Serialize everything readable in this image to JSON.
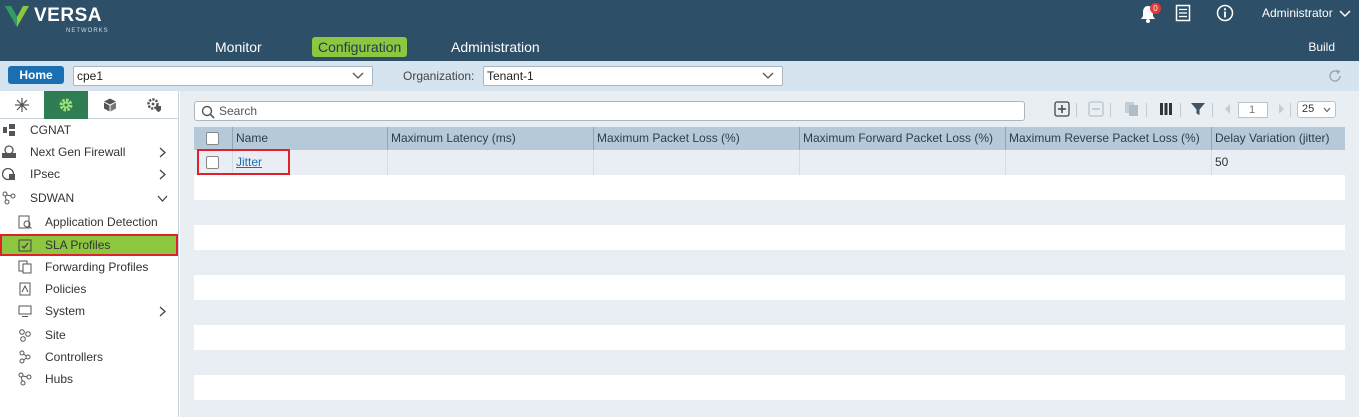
{
  "header": {
    "brand": "VERSA",
    "brand_sub": "NETWORKS",
    "nav": [
      "Monitor",
      "Configuration",
      "Administration"
    ],
    "build_label": "Build",
    "notification_count": "0",
    "user": "Administrator",
    "accent_color": "#8dc63f",
    "bar_color": "#2e4f68"
  },
  "subbar": {
    "home_label": "Home",
    "device": "cpe1",
    "org_label": "Organization:",
    "org_value": "Tenant-1"
  },
  "sidebar": {
    "tabs": [
      "network-icon",
      "gear-icon",
      "cube-icon",
      "gear-shield-icon"
    ],
    "items": [
      {
        "label": "CGNAT"
      },
      {
        "label": "Next Gen Firewall"
      },
      {
        "label": "IPsec"
      },
      {
        "label": "SDWAN"
      },
      {
        "label": "Application Detection"
      },
      {
        "label": "SLA Profiles"
      },
      {
        "label": "Forwarding Profiles"
      },
      {
        "label": "Policies"
      },
      {
        "label": "System"
      },
      {
        "label": "Site"
      },
      {
        "label": "Controllers"
      },
      {
        "label": "Hubs"
      }
    ]
  },
  "toolbar": {
    "search_placeholder": "Search",
    "page": "1",
    "page_size": "25"
  },
  "table": {
    "columns": [
      "Name",
      "Maximum Latency (ms)",
      "Maximum Packet Loss (%)",
      "Maximum Forward Packet Loss (%)",
      "Maximum Reverse Packet Loss (%)",
      "Delay Variation (jitter)"
    ],
    "rows": [
      {
        "name": "Jitter",
        "max_latency": "",
        "max_packet_loss": "",
        "max_fwd_loss": "",
        "max_rev_loss": "",
        "jitter": "50"
      }
    ]
  }
}
